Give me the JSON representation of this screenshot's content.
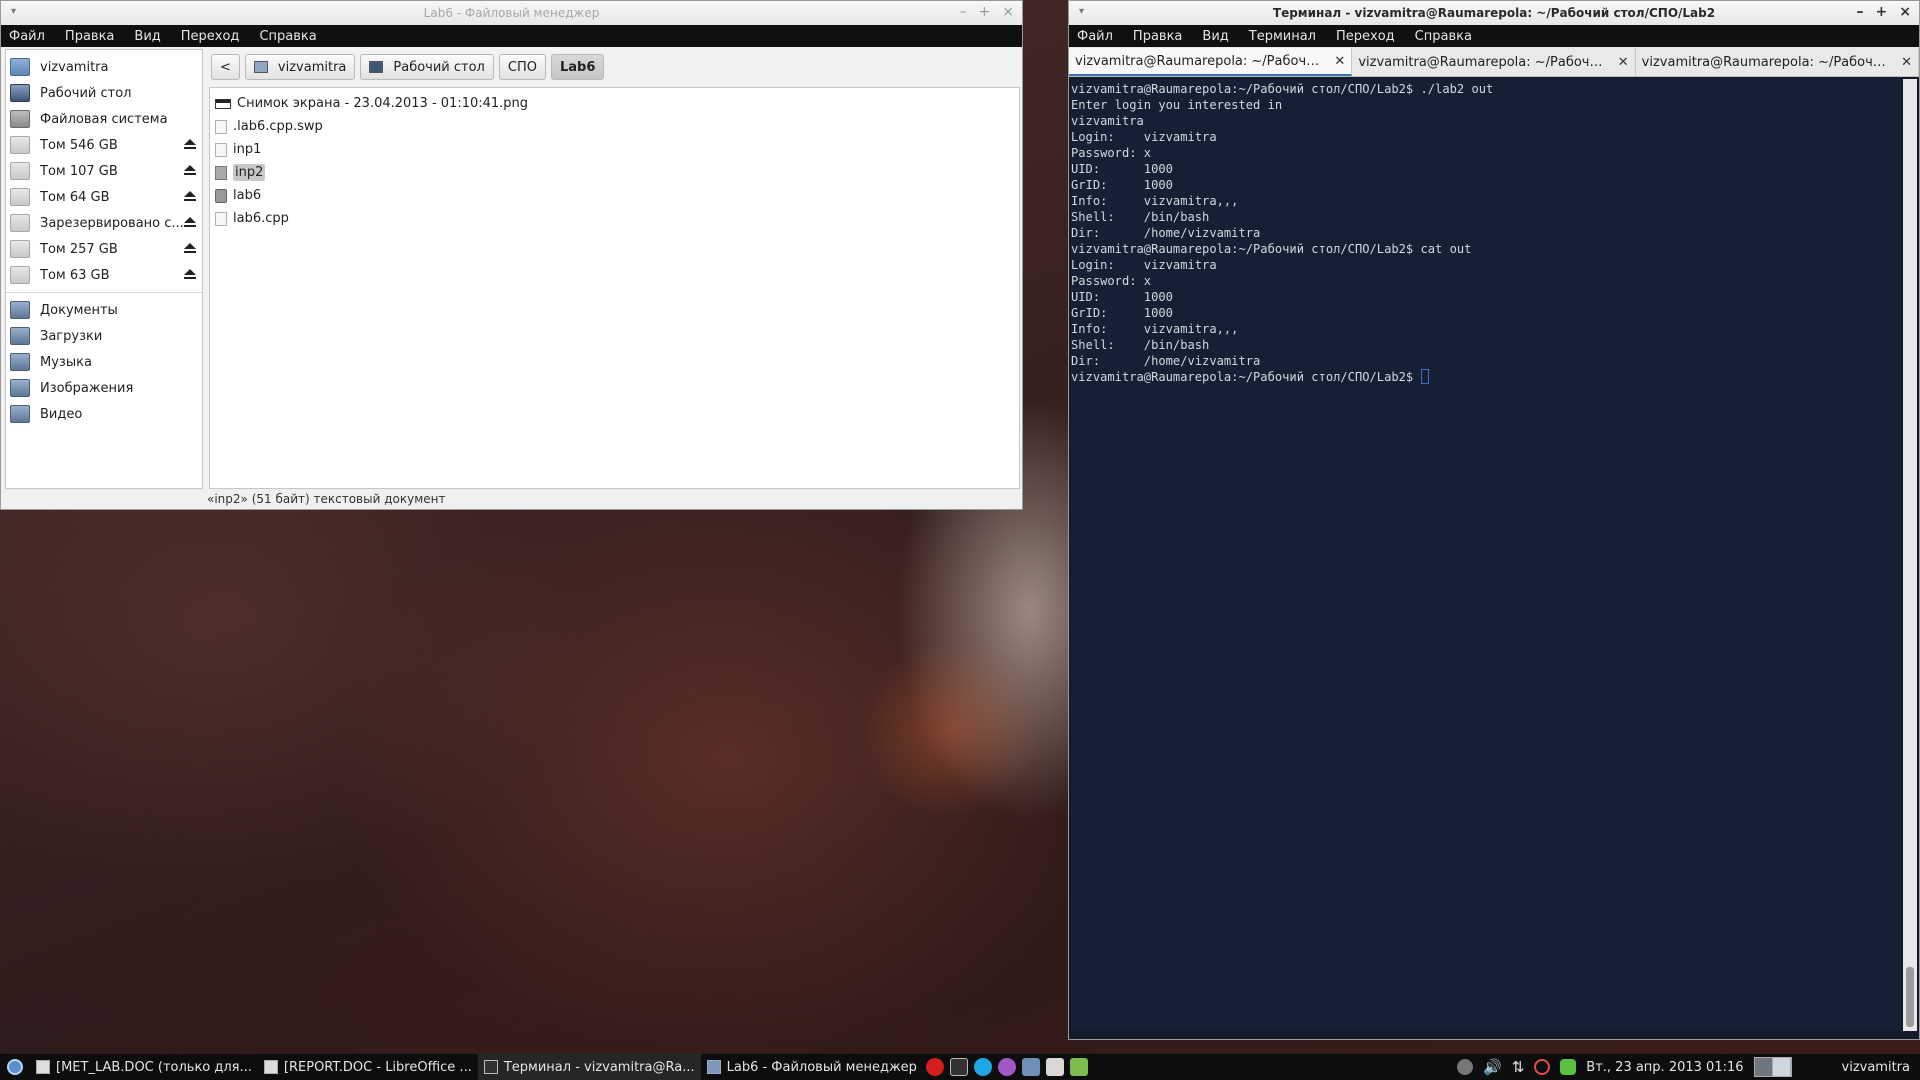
{
  "colors": {
    "terminal_bg": "#152035",
    "menubar_bg": "#101010",
    "taskbar_bg": "#0d0d0d",
    "selection": "#c8c8c8",
    "cursor": "#3b6fd0"
  },
  "file_manager": {
    "title": "Lab6 - Файловый менеджер",
    "menu": [
      "Файл",
      "Правка",
      "Вид",
      "Переход",
      "Справка"
    ],
    "sidebar": {
      "places": [
        {
          "label": "vizvamitra",
          "icon": "home-icon"
        },
        {
          "label": "Рабочий стол",
          "icon": "desktop-icon"
        },
        {
          "label": "Файловая система",
          "icon": "filesystem-icon"
        }
      ],
      "devices": [
        {
          "label": "Том 546 GB"
        },
        {
          "label": "Том 107 GB"
        },
        {
          "label": "Том 64 GB"
        },
        {
          "label": "Зарезервировано с..."
        },
        {
          "label": "Том 257 GB"
        },
        {
          "label": "Том 63 GB"
        }
      ],
      "bookmarks": [
        {
          "label": "Документы"
        },
        {
          "label": "Загрузки"
        },
        {
          "label": "Музыка"
        },
        {
          "label": "Изображения"
        },
        {
          "label": "Видео"
        }
      ]
    },
    "path": [
      "vizvamitra",
      "Рабочий стол",
      "СПО",
      "Lab6"
    ],
    "back_label": "<",
    "files": [
      {
        "name": "Снимок экрана - 23.04.2013 - 01:10:41.png",
        "icon": "image-file-icon"
      },
      {
        "name": ".lab6.cpp.swp",
        "icon": "text-file-icon"
      },
      {
        "name": "inp1",
        "icon": "text-file-icon"
      },
      {
        "name": "inp2",
        "icon": "text-file-icon",
        "selected": true
      },
      {
        "name": "lab6",
        "icon": "executable-icon"
      },
      {
        "name": "lab6.cpp",
        "icon": "text-file-icon"
      }
    ],
    "status": "«inp2» (51 байт) текстовый документ"
  },
  "terminal": {
    "title": "Терминал - vizvamitra@Raumarepola: ~/Рабочий стол/СПО/Lab2",
    "menu": [
      "Файл",
      "Правка",
      "Вид",
      "Терминал",
      "Переход",
      "Справка"
    ],
    "tabs": [
      {
        "label": "vizvamitra@Raumarepola: ~/Рабочий ...",
        "close": "✕"
      },
      {
        "label": "vizvamitra@Raumarepola: ~/Рабочий ...",
        "close": "✕"
      },
      {
        "label": "vizvamitra@Raumarepola: ~/Рабочий ...",
        "close": "✕"
      }
    ],
    "lines": [
      "vizvamitra@Raumarepola:~/Рабочий стол/СПО/Lab2$ ./lab2 out",
      "Enter login you interested in",
      "vizvamitra",
      "",
      "Login:    vizvamitra",
      "Password: x",
      "UID:      1000",
      "GrID:     1000",
      "Info:     vizvamitra,,,",
      "Shell:    /bin/bash",
      "Dir:      /home/vizvamitra",
      "",
      "vizvamitra@Raumarepola:~/Рабочий стол/СПО/Lab2$ cat out",
      "Login:    vizvamitra",
      "Password: x",
      "UID:      1000",
      "GrID:     1000",
      "Info:     vizvamitra,,,",
      "Shell:    /bin/bash",
      "Dir:      /home/vizvamitra"
    ],
    "prompt": "vizvamitra@Raumarepola:~/Рабочий стол/СПО/Lab2$ "
  },
  "taskbar": {
    "tasks": [
      {
        "label": "[MET_LAB.DOC (только для...",
        "icon": "document-icon"
      },
      {
        "label": "[REPORT.DOC - LibreOffice ...",
        "icon": "document-icon"
      },
      {
        "label": "Терминал - vizvamitra@Ra...",
        "icon": "terminal-icon",
        "active": true
      },
      {
        "label": "Lab6 - Файловый менеджер",
        "icon": "folder-icon"
      }
    ],
    "launchers": [
      {
        "icon": "opera-icon",
        "color": "#d41e1e"
      },
      {
        "icon": "terminal-launcher-icon",
        "color": "#333333"
      },
      {
        "icon": "skype-icon",
        "color": "#1ea7e4"
      },
      {
        "icon": "messenger-icon",
        "color": "#a257c8"
      },
      {
        "icon": "file-manager-launcher-icon",
        "color": "#6f8fb8"
      },
      {
        "icon": "text-editor-launcher-icon",
        "color": "#d8d8d8"
      },
      {
        "icon": "notes-launcher-icon",
        "color": "#7dbb4c"
      }
    ],
    "clock": "Вт., 23 апр. 2013 01:16",
    "user": "vizvamitra"
  }
}
